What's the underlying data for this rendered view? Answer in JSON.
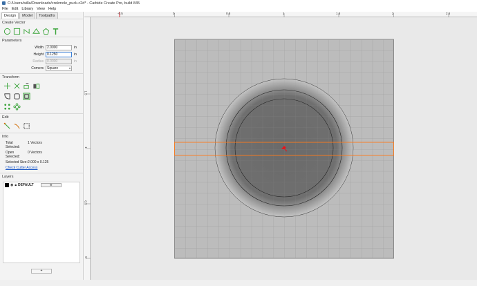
{
  "window": {
    "title": "C:/Users/willa/Downloads/crekmole_puck.c2d* - Carbide Create Pro, build 845"
  },
  "menu": [
    "File",
    "Edit",
    "Library",
    "View",
    "Help"
  ],
  "tabs": [
    "Design",
    "Model",
    "Toolpaths"
  ],
  "active_tab": "Design",
  "sections": {
    "create_vector": "Create Vector",
    "parameters": "Parameters",
    "transform": "Transform",
    "edit": "Edit",
    "info": "Info",
    "layers": "Layers"
  },
  "parameters": {
    "width_label": "Width",
    "width_value": "2.0000",
    "width_unit": "in",
    "height_label": "Height",
    "height_value": "0.1250",
    "height_unit": "in",
    "radius_label": "Radius",
    "radius_value": "0.0000",
    "radius_unit": "in",
    "corners_label": "Corners",
    "corners_value": "Square"
  },
  "info": {
    "total_selected_label": "Total Selected:",
    "total_selected_value": "1 Vectors",
    "open_selected_label": "Open Selected:",
    "open_selected_value": "0 Vectors",
    "selected_size_label": "Selected Size:",
    "selected_size_value": "2.000 x 0.125",
    "check_cutter_access": "Check Cutter Access"
  },
  "layers": [
    {
      "name": "DEFAULT",
      "color": "#000000"
    }
  ],
  "layer_add_label": "+",
  "ruler": {
    "h_labels": [
      "-0.5",
      "0",
      "0.5",
      "1",
      "1.5",
      "2",
      "2.5"
    ],
    "v_labels": [
      "1.5",
      "1",
      "0.5",
      "0"
    ]
  },
  "colors": {
    "stock": "#bcbcbc",
    "selection": "#ff7a1a",
    "origin_marker": "#e8141b"
  }
}
